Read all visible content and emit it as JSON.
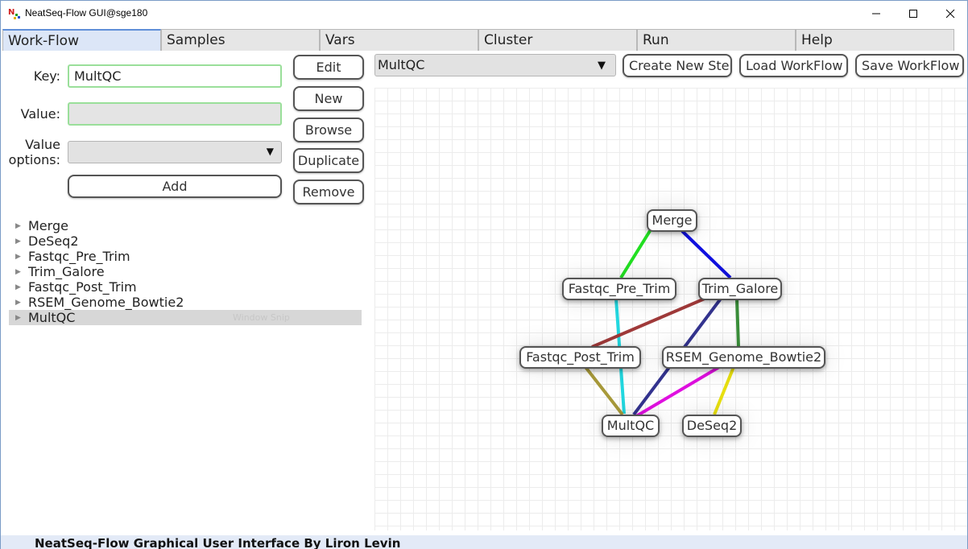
{
  "window": {
    "title": "NeatSeq-Flow GUI@sge180",
    "controls": {
      "minimize_icon": "minimize-icon",
      "maximize_icon": "maximize-icon",
      "close_icon": "close-icon"
    }
  },
  "tabs": [
    {
      "label": "Work-Flow",
      "active": true
    },
    {
      "label": "Samples"
    },
    {
      "label": "Vars"
    },
    {
      "label": "Cluster"
    },
    {
      "label": "Run"
    },
    {
      "label": "Help"
    }
  ],
  "left_panel": {
    "key_label": "Key:",
    "key_value": "MultQC",
    "value_label": "Value:",
    "value_value": "",
    "value_options_label_1": "Value",
    "value_options_label_2": "options:",
    "value_options_selected": "",
    "add_label": "Add",
    "buttons": {
      "edit": "Edit",
      "new": "New",
      "browse": "Browse",
      "duplicate": "Duplicate",
      "remove": "Remove"
    },
    "tree": [
      {
        "label": "Merge"
      },
      {
        "label": "DeSeq2"
      },
      {
        "label": "Fastqc_Pre_Trim"
      },
      {
        "label": "Trim_Galore"
      },
      {
        "label": "Fastqc_Post_Trim"
      },
      {
        "label": "RSEM_Genome_Bowtie2"
      },
      {
        "label": "MultQC",
        "selected": true
      }
    ],
    "snip_overlay": "Window Snip"
  },
  "right_panel": {
    "step_selected": "MultQC",
    "buttons": {
      "create": "Create New Step",
      "load": "Load WorkFlow",
      "save": "Save WorkFlow"
    },
    "graph": {
      "nodes": [
        "Merge",
        "Fastqc_Pre_Trim",
        "Trim_Galore",
        "Fastqc_Post_Trim",
        "RSEM_Genome_Bowtie2",
        "MultQC",
        "DeSeq2"
      ],
      "edges": [
        {
          "from": "Merge",
          "to": "Fastqc_Pre_Trim",
          "color": "#22e022"
        },
        {
          "from": "Merge",
          "to": "Trim_Galore",
          "color": "#1010e0"
        },
        {
          "from": "Fastqc_Pre_Trim",
          "to": "MultQC",
          "color": "#22d8e0"
        },
        {
          "from": "Trim_Galore",
          "to": "Fastqc_Post_Trim",
          "color": "#a03a3a"
        },
        {
          "from": "Trim_Galore",
          "to": "RSEM_Genome_Bowtie2",
          "color": "#3a8f3a"
        },
        {
          "from": "Trim_Galore",
          "to": "MultQC",
          "color": "#33338f"
        },
        {
          "from": "Fastqc_Post_Trim",
          "to": "MultQC",
          "color": "#a89a3a"
        },
        {
          "from": "RSEM_Genome_Bowtie2",
          "to": "MultQC",
          "color": "#e010e0"
        },
        {
          "from": "RSEM_Genome_Bowtie2",
          "to": "DeSeq2",
          "color": "#e8e010"
        }
      ]
    }
  },
  "status_bar": {
    "text": "NeatSeq-Flow Graphical User Interface By Liron Levin"
  }
}
